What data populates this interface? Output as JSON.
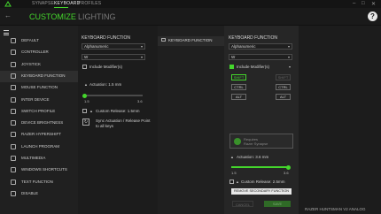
{
  "app": {
    "tabs": [
      "SYNAPSE",
      "KEYBOARD",
      "PROFILES"
    ],
    "active_tab": "KEYBOARD",
    "window_controls": [
      "–",
      "□",
      "✕"
    ],
    "brand_color": "#44d62c"
  },
  "subnav": {
    "customize": "CUSTOMIZE",
    "lighting": "LIGHTING",
    "help": "?"
  },
  "sidebar": {
    "items": [
      {
        "label": "DEFAULT",
        "icon": "default-icon"
      },
      {
        "label": "CONTROLLER",
        "icon": "controller-icon"
      },
      {
        "label": "JOYSTICK",
        "icon": "joystick-icon"
      },
      {
        "label": "KEYBOARD FUNCTION",
        "icon": "keyboard-icon",
        "selected": true
      },
      {
        "label": "MOUSE FUNCTION",
        "icon": "mouse-icon"
      },
      {
        "label": "INTER DEVICE",
        "icon": "inter-device-icon"
      },
      {
        "label": "SWITCH PROFILE",
        "icon": "switch-profile-icon"
      },
      {
        "label": "DEVICE BRIGHTNESS",
        "icon": "brightness-icon"
      },
      {
        "label": "RAZER HYPERSHIFT",
        "icon": "hypershift-icon"
      },
      {
        "label": "LAUNCH PROGRAM",
        "icon": "launch-program-icon"
      },
      {
        "label": "MULTIMEDIA",
        "icon": "multimedia-icon"
      },
      {
        "label": "WINDOWS SHORTCUTS",
        "icon": "windows-shortcuts-icon"
      },
      {
        "label": "TEXT FUNCTION",
        "icon": "text-function-icon"
      },
      {
        "label": "DISABLE",
        "icon": "disable-icon"
      }
    ]
  },
  "left_panel": {
    "title": "KEYBOARD FUNCTION",
    "type_select": "Alphanumeric",
    "key_select": "W",
    "include_modifiers": "Include Modifier(s)",
    "actuation_label": "Actuation: 1.5 mm",
    "slider_min": "1.5",
    "slider_max": "3.6",
    "actuation_fraction": 0.0,
    "custom_release": "Custom Release: 1.5mm",
    "sync_actuation": "Sync Actuation / Release Point to all keys"
  },
  "middle_header": {
    "label": "KEYBOARD FUNCTION"
  },
  "right_panel": {
    "title": "KEYBOARD FUNCTION",
    "type_select": "Alphanumeric",
    "key_select": "W",
    "include_modifiers": "Include Modifier(s)",
    "include_modifiers_checked": true,
    "modifier_select": "",
    "modifiers": [
      {
        "label": "SHIFT",
        "state": "on"
      },
      {
        "label": "SHIFT",
        "state": "disabled"
      },
      {
        "label": "CTRL",
        "state": "off"
      },
      {
        "label": "CTRL",
        "state": "off"
      },
      {
        "label": "ALT",
        "state": "off"
      },
      {
        "label": "ALT",
        "state": "off"
      }
    ],
    "drop_line1": "Requires",
    "drop_line2": "Razer Synapse",
    "actuation_label": "Actuation: 3.6 mm",
    "slider_min": "1.5",
    "slider_max": "3.6",
    "actuation_fraction": 1.0,
    "custom_release": "Custom Release: 2.5mm",
    "remove_btn": "REMOVE SECONDARY FUNCTION",
    "cancel_btn": "CANCEL",
    "save_btn": "SAVE"
  },
  "footer": {
    "device": "RAZER HUNTSMAN V2 ANALOG"
  }
}
